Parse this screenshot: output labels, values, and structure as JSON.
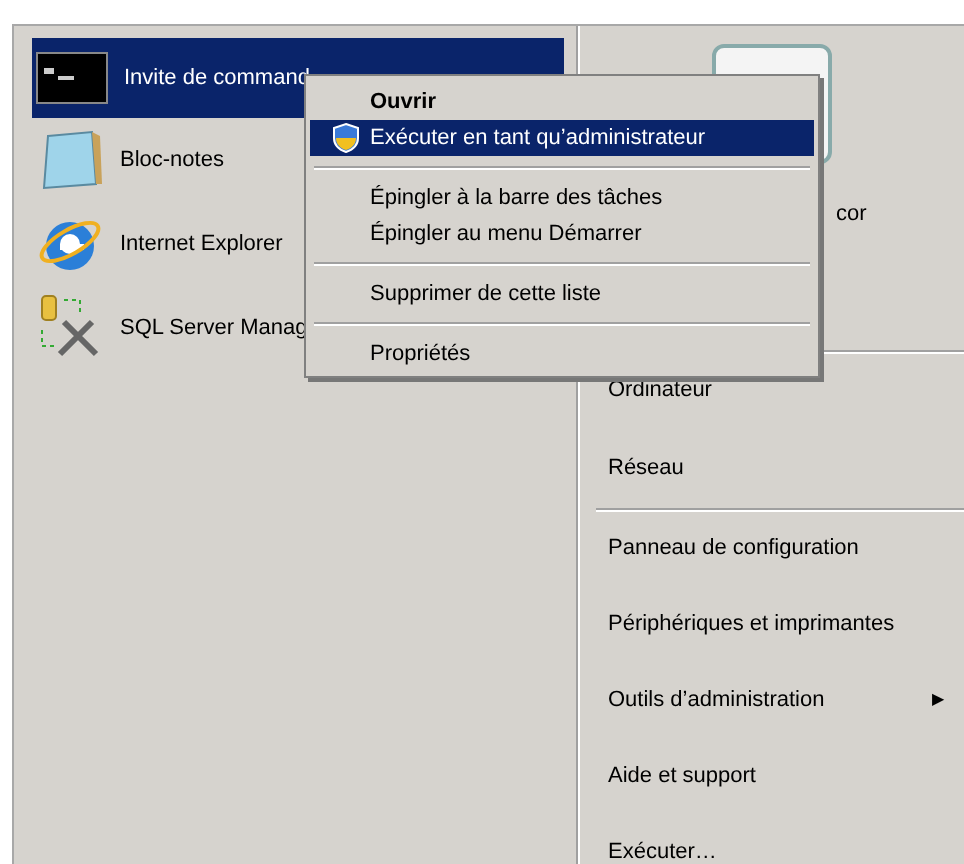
{
  "programs": [
    {
      "label": "Invite de command",
      "kind": "console",
      "selected": true
    },
    {
      "label": "Bloc-notes",
      "kind": "notepad",
      "selected": false
    },
    {
      "label": "Internet Explorer",
      "kind": "browser",
      "selected": false
    },
    {
      "label": "SQL Server Manag",
      "kind": "tools",
      "selected": false
    }
  ],
  "right_groups": [
    [
      {
        "label": "cor"
      }
    ],
    [
      {
        "label": "Ordinateur"
      },
      {
        "label": "Réseau"
      }
    ],
    [
      {
        "label": "Panneau de configuration"
      },
      {
        "label": "Périphériques et imprimantes"
      },
      {
        "label": "Outils d’administration",
        "submenu_arrow": "▶"
      },
      {
        "label": "Aide et support"
      },
      {
        "label": "Exécuter…"
      }
    ]
  ],
  "context_menu": [
    {
      "kind": "item",
      "label": "Ouvrir",
      "default": true,
      "selected": false
    },
    {
      "kind": "shield_item",
      "label": "Exécuter en tant qu’administrateur",
      "default": false,
      "selected": true
    },
    {
      "kind": "separator"
    },
    {
      "kind": "item",
      "label": "Épingler à la barre des tâches",
      "default": false,
      "selected": false
    },
    {
      "kind": "item",
      "label": "Épingler au menu Démarrer",
      "default": false,
      "selected": false
    },
    {
      "kind": "separator"
    },
    {
      "kind": "item",
      "label": "Supprimer de cette liste",
      "default": false,
      "selected": false
    },
    {
      "kind": "separator"
    },
    {
      "kind": "item",
      "label": "Propriétés",
      "default": false,
      "selected": false
    }
  ]
}
